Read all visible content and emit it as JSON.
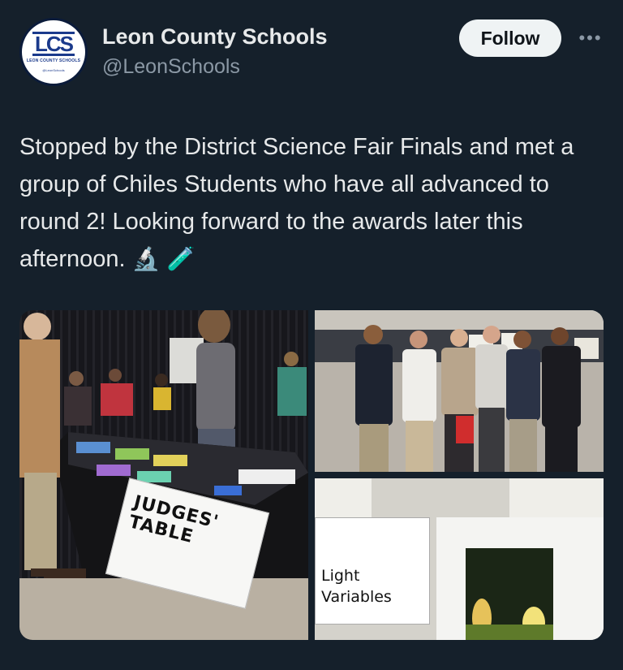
{
  "account": {
    "name": "Leon County Schools",
    "handle": "@LeonSchools",
    "logo_letters": "LCS",
    "logo_subtitle": "LEON COUNTY SCHOOLS",
    "logo_handle": "@LeonSchools"
  },
  "actions": {
    "follow_label": "Follow",
    "more_label": "•••"
  },
  "tweet": {
    "text": "Stopped by the District Science Fair Finals and met a group of Chiles Students who have all advanced to round 2! Looking forward to the awards later this afternoon.",
    "emoji_1": "🔬",
    "emoji_2": "🧪"
  },
  "media": {
    "photo1_sign": "JUDGES' TABLE",
    "photo3_sign_line1": "Light",
    "photo3_sign_line2": "Variables"
  },
  "colors": {
    "background": "#15202b",
    "text": "#e7e9ea",
    "secondary_text": "#8b98a5",
    "follow_bg": "#eff3f4"
  }
}
